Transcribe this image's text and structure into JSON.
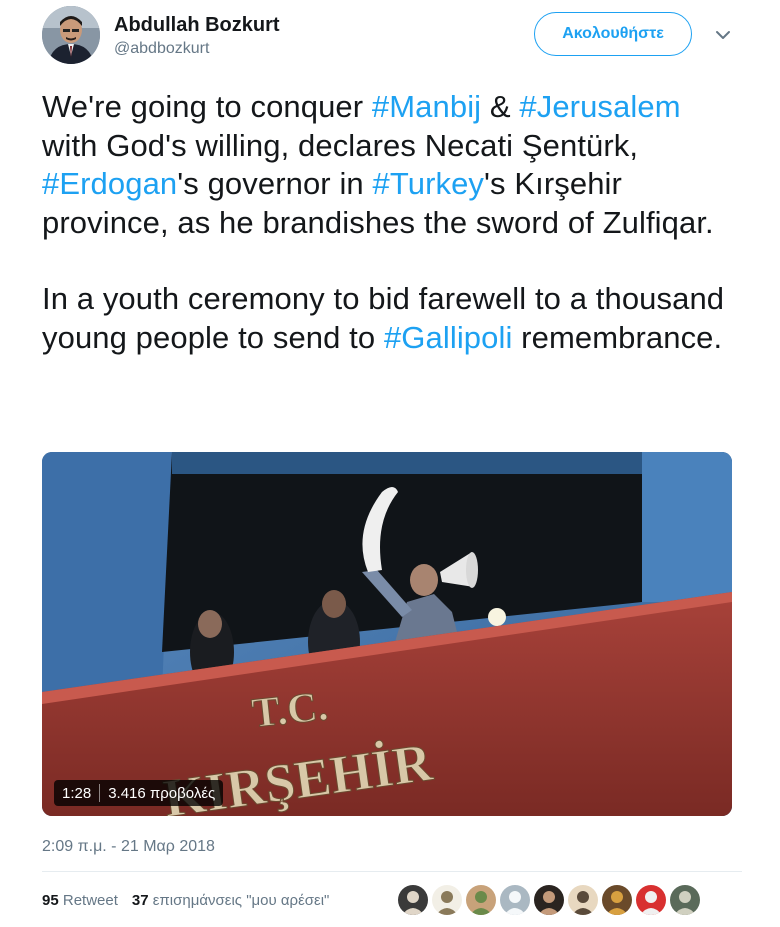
{
  "author": {
    "name": "Abdullah Bozkurt",
    "handle": "@abdbozkurt"
  },
  "follow_label": "Ακολουθήστε",
  "tweet": {
    "p1": [
      {
        "t": "We're going to conquer ",
        "tag": false
      },
      {
        "t": "#Manbij",
        "tag": true
      },
      {
        "t": " & ",
        "tag": false
      },
      {
        "t": "#Jerusalem",
        "tag": true
      },
      {
        "t": " with God's willing, declares Necati Şentürk, ",
        "tag": false
      },
      {
        "t": "#Erdogan",
        "tag": true
      },
      {
        "t": "'s governor in ",
        "tag": false
      },
      {
        "t": "#Turkey",
        "tag": true
      },
      {
        "t": "'s Kırşehir province, as he brandishes the sword of Zulfiqar.",
        "tag": false
      }
    ],
    "p2": [
      {
        "t": "In a youth ceremony to bid farewell to a thousand young people to send to ",
        "tag": false
      },
      {
        "t": "#Gallipoli",
        "tag": true
      },
      {
        "t": " remembrance.",
        "tag": false
      }
    ]
  },
  "media": {
    "duration": "1:28",
    "views": "3.416 προβολές",
    "sign_line1": "T.C.",
    "sign_line2": "KIRŞEHİR"
  },
  "timestamp": "2:09 π.μ. - 21 Μαρ 2018",
  "stats": {
    "retweets_count": "95",
    "retweets_label": "Retweet",
    "likes_count": "37",
    "likes_label": "επισημάνσεις \"μου αρέσει\""
  },
  "colors": {
    "accent": "#1da1f2",
    "text": "#14171a",
    "muted": "#657786"
  },
  "liker_avatars": [
    {
      "name": "liker-avatar-1",
      "bg": "#3a3a3a",
      "fg": "#e0d6c8"
    },
    {
      "name": "liker-avatar-2",
      "bg": "#f2efe6",
      "fg": "#8a7a5a"
    },
    {
      "name": "liker-avatar-3",
      "bg": "#c8a27a",
      "fg": "#6a8a4a"
    },
    {
      "name": "liker-avatar-4",
      "bg": "#aab8c2",
      "fg": "#f5f8fa"
    },
    {
      "name": "liker-avatar-5",
      "bg": "#2a2420",
      "fg": "#c49a7a"
    },
    {
      "name": "liker-avatar-6",
      "bg": "#e8d8c0",
      "fg": "#5a4a3a"
    },
    {
      "name": "liker-avatar-7",
      "bg": "#6a4a2a",
      "fg": "#d8a040"
    },
    {
      "name": "liker-avatar-8",
      "bg": "#d83030",
      "fg": "#f0f0f0"
    },
    {
      "name": "liker-avatar-9",
      "bg": "#5a6a5a",
      "fg": "#d0d0c0"
    }
  ]
}
